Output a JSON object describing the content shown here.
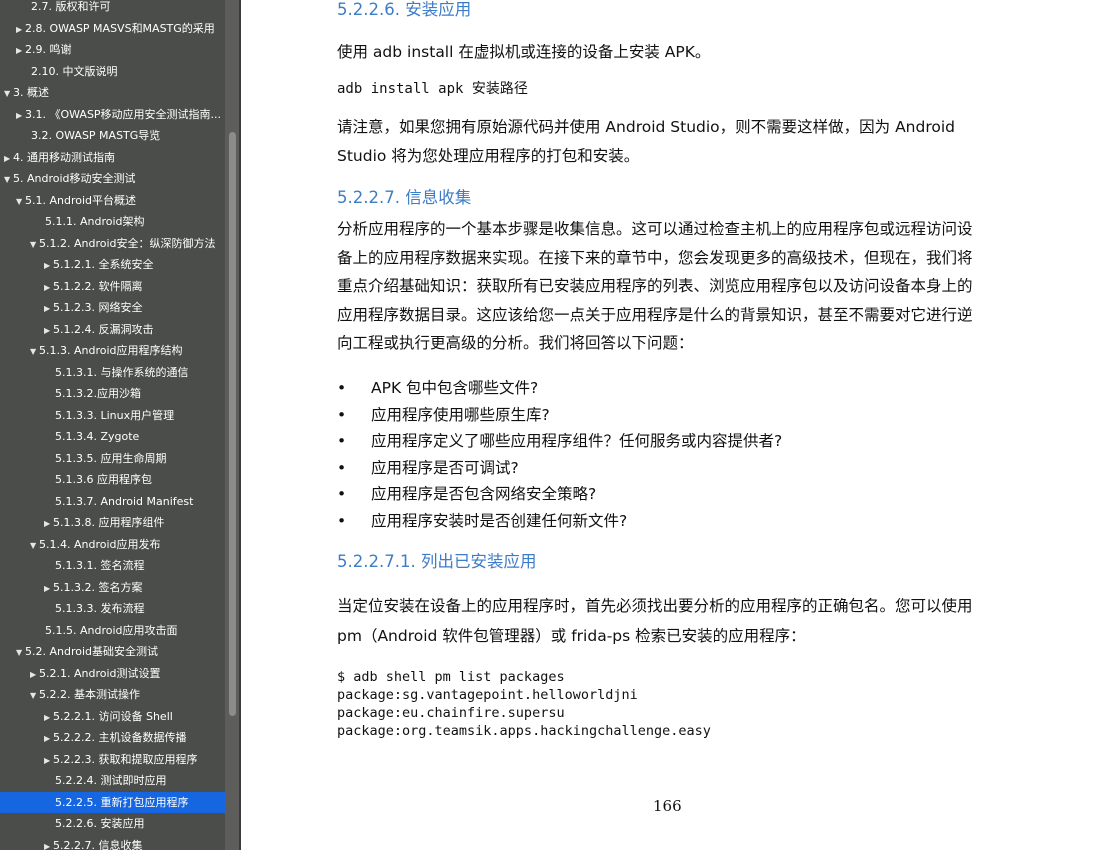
{
  "toc": [
    {
      "label": "2.7. 版权和许可",
      "arrow": "",
      "level": 2,
      "selected": false
    },
    {
      "label": "2.8. OWASP MASVS和MASTG的采用",
      "arrow": "▶",
      "level": 1,
      "selected": false
    },
    {
      "label": "2.9. 鸣谢",
      "arrow": "▶",
      "level": 1,
      "selected": false
    },
    {
      "label": "2.10. 中文版说明",
      "arrow": "",
      "level": 2,
      "selected": false
    },
    {
      "label": "3. 概述",
      "arrow": "▼",
      "level": 0,
      "selected": false
    },
    {
      "label": "3.1. 《OWASP移动应用安全测试指南...",
      "arrow": "▶",
      "level": 1,
      "selected": false
    },
    {
      "label": "3.2. OWASP MASTG导览",
      "arrow": "",
      "level": 2,
      "selected": false
    },
    {
      "label": "4. 通用移动测试指南",
      "arrow": "▶",
      "level": 0,
      "selected": false
    },
    {
      "label": "5. Android移动安全测试",
      "arrow": "▼",
      "level": 0,
      "selected": false
    },
    {
      "label": "5.1. Android平台概述",
      "arrow": "▼",
      "level": 1,
      "selected": false
    },
    {
      "label": "5.1.1. Android架构",
      "arrow": "",
      "level": 3,
      "selected": false
    },
    {
      "label": "5.1.2. Android安全：纵深防御方法",
      "arrow": "▼",
      "level": 2,
      "selected": false
    },
    {
      "label": "5.1.2.1. 全系统安全",
      "arrow": "▶",
      "level": 3,
      "selected": false
    },
    {
      "label": "5.1.2.2. 软件隔离",
      "arrow": "▶",
      "level": 3,
      "selected": false
    },
    {
      "label": "5.1.2.3. 网络安全",
      "arrow": "▶",
      "level": 3,
      "selected": false
    },
    {
      "label": "5.1.2.4. 反漏洞攻击",
      "arrow": "▶",
      "level": 3,
      "selected": false
    },
    {
      "label": "5.1.3. Android应用程序结构",
      "arrow": "▼",
      "level": 2,
      "selected": false
    },
    {
      "label": "5.1.3.1. 与操作系统的通信",
      "arrow": "",
      "level": 4,
      "selected": false
    },
    {
      "label": "5.1.3.2.应用沙箱",
      "arrow": "",
      "level": 4,
      "selected": false
    },
    {
      "label": "5.1.3.3. Linux用户管理",
      "arrow": "",
      "level": 4,
      "selected": false
    },
    {
      "label": "5.1.3.4. Zygote",
      "arrow": "",
      "level": 4,
      "selected": false
    },
    {
      "label": "5.1.3.5. 应用生命周期",
      "arrow": "",
      "level": 4,
      "selected": false
    },
    {
      "label": "5.1.3.6 应用程序包",
      "arrow": "",
      "level": 4,
      "selected": false
    },
    {
      "label": "5.1.3.7. Android Manifest",
      "arrow": "",
      "level": 4,
      "selected": false
    },
    {
      "label": "5.1.3.8. 应用程序组件",
      "arrow": "▶",
      "level": 3,
      "selected": false
    },
    {
      "label": "5.1.4. Android应用发布",
      "arrow": "▼",
      "level": 2,
      "selected": false
    },
    {
      "label": "5.1.3.1. 签名流程",
      "arrow": "",
      "level": 4,
      "selected": false
    },
    {
      "label": "5.1.3.2. 签名方案",
      "arrow": "▶",
      "level": 3,
      "selected": false
    },
    {
      "label": "5.1.3.3. 发布流程",
      "arrow": "",
      "level": 4,
      "selected": false
    },
    {
      "label": "5.1.5. Android应用攻击面",
      "arrow": "",
      "level": 3,
      "selected": false
    },
    {
      "label": "5.2. Android基础安全测试",
      "arrow": "▼",
      "level": 1,
      "selected": false
    },
    {
      "label": "5.2.1. Android测试设置",
      "arrow": "▶",
      "level": 2,
      "selected": false
    },
    {
      "label": "5.2.2. 基本测试操作",
      "arrow": "▼",
      "level": 2,
      "selected": false
    },
    {
      "label": "5.2.2.1. 访问设备 Shell",
      "arrow": "▶",
      "level": 3,
      "selected": false
    },
    {
      "label": "5.2.2.2. 主机设备数据传播",
      "arrow": "▶",
      "level": 3,
      "selected": false
    },
    {
      "label": "5.2.2.3. 获取和提取应用程序",
      "arrow": "▶",
      "level": 3,
      "selected": false
    },
    {
      "label": "5.2.2.4. 测试即时应用",
      "arrow": "",
      "level": 4,
      "selected": false
    },
    {
      "label": "5.2.2.5. 重新打包应用程序",
      "arrow": "",
      "level": 4,
      "selected": true
    },
    {
      "label": "5.2.2.6. 安装应用",
      "arrow": "",
      "level": 4,
      "selected": false
    },
    {
      "label": "5.2.2.7. 信息收集",
      "arrow": "▶",
      "level": 3,
      "selected": false
    }
  ],
  "doc": {
    "heading_install": "5.2.2.6. 安装应用",
    "para_install": "使用 adb install 在虚拟机或连接的设备上安装 APK。",
    "cmd_install": "adb install apk 安装路径",
    "para_note": "请注意，如果您拥有原始源代码并使用 Android Studio，则不需要这样做，因为 Android Studio 将为您处理应用程序的打包和安装。",
    "heading_info": "5.2.2.7. 信息收集",
    "para_info": "分析应用程序的一个基本步骤是收集信息。这可以通过检查主机上的应用程序包或远程访问设备上的应用程序数据来实现。在接下来的章节中，您会发现更多的高级技术，但现在，我们将重点介绍基础知识：获取所有已安装应用程序的列表、浏览应用程序包以及访问设备本身上的应用程序数据目录。这应该给您一点关于应用程序是什么的背景知识，甚至不需要对它进行逆向工程或执行更高级的分析。我们将回答以下问题：",
    "bullets": [
      "APK 包中包含哪些文件?",
      "应用程序使用哪些原生库?",
      "应用程序定义了哪些应用程序组件？任何服务或内容提供者?",
      "应用程序是否可调试?",
      "应用程序是否包含网络安全策略?",
      "应用程序安装时是否创建任何新文件?"
    ],
    "heading_list": "5.2.2.7.1. 列出已安装应用",
    "para_list": "当定位安装在设备上的应用程序时，首先必须找出要分析的应用程序的正确包名。您可以使用 pm（Android 软件包管理器）或 frida-ps 检索已安装的应用程序：",
    "code_block": "$ adb shell pm list packages\npackage:sg.vantagepoint.helloworldjni\npackage:eu.chainfire.supersu\npackage:org.teamsik.apps.hackingchallenge.easy",
    "page_number": "166"
  },
  "colors": {
    "sidebar_bg": "#4b4d4b",
    "selected_bg": "#1566e0",
    "heading": "#3c7cc8"
  }
}
